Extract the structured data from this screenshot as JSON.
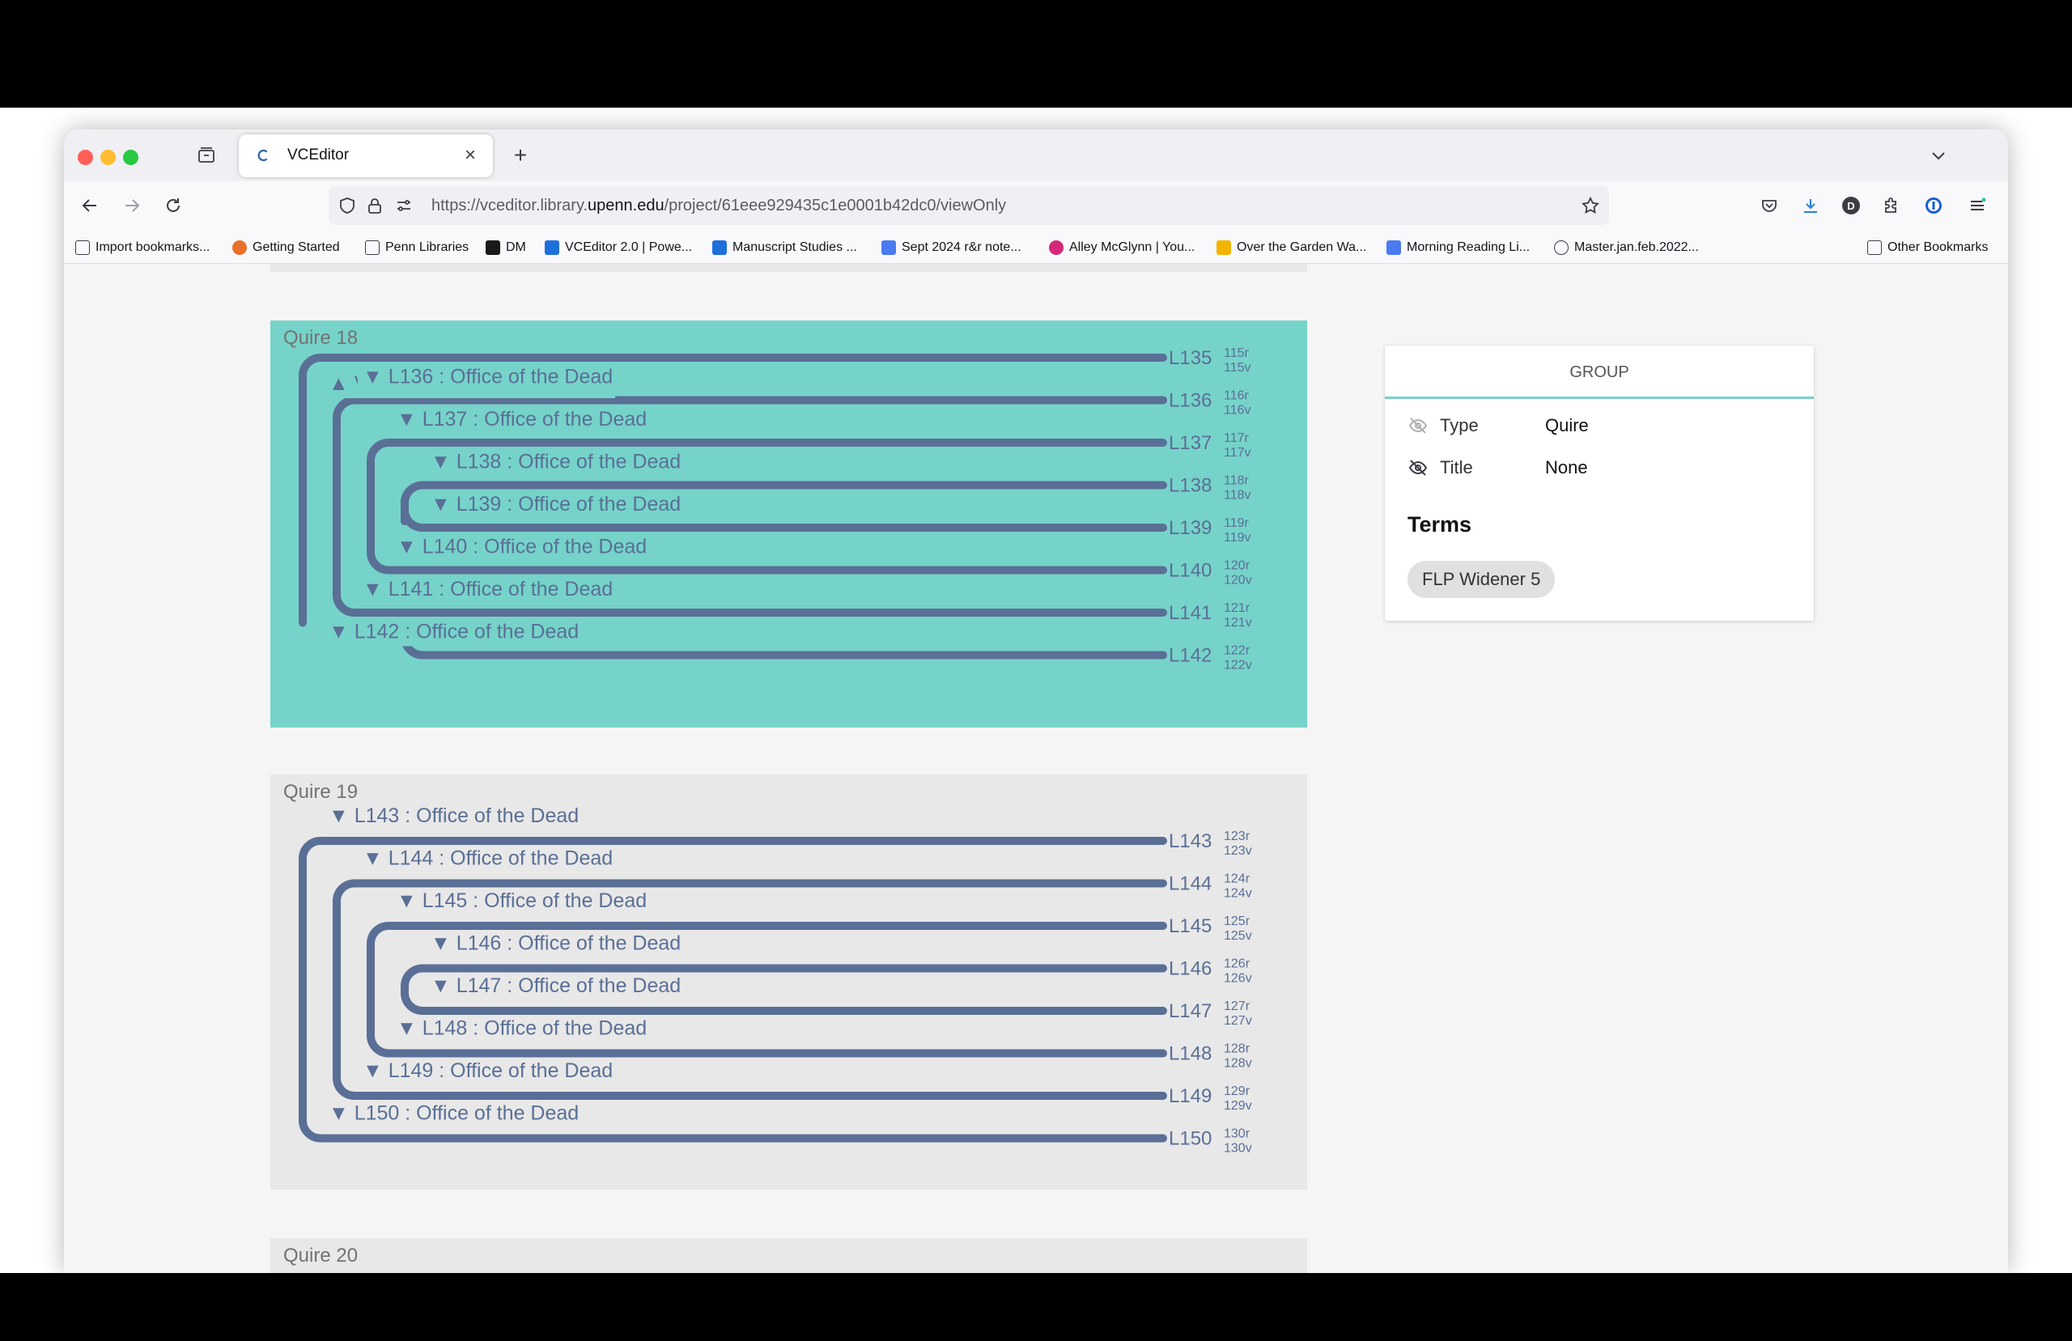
{
  "browser": {
    "tab_title": "VCEditor",
    "url_prefix": "https://vceditor.library.",
    "url_domain": "upenn.edu",
    "url_path": "/project/61eee929435c1e0001b42dc0/viewOnly",
    "new_tab_glyph": "+",
    "close_glyph": "×",
    "bookmarks": [
      {
        "label": "Import bookmarks...",
        "icon": "import-icon"
      },
      {
        "label": "Getting Started",
        "icon": "firefox-icon",
        "color": "#e8702a"
      },
      {
        "label": "Penn Libraries",
        "icon": "folder-icon"
      },
      {
        "label": "DM",
        "icon": "dm-icon",
        "color": "#1a1a1a"
      },
      {
        "label": "VCEditor 2.0 | Powe...",
        "icon": "box-icon",
        "color": "#1d6fdc"
      },
      {
        "label": "Manuscript Studies ...",
        "icon": "box-icon",
        "color": "#1d6fdc"
      },
      {
        "label": "Sept 2024 r&r note...",
        "icon": "docs-icon",
        "color": "#4a7bf0"
      },
      {
        "label": "Alley McGlynn | You...",
        "icon": "instagram-icon",
        "color": "#d6287a"
      },
      {
        "label": "Over the Garden Wa...",
        "icon": "drive-icon",
        "color": "#f4b400"
      },
      {
        "label": "Morning Reading Li...",
        "icon": "docs-icon",
        "color": "#4a7bf0"
      },
      {
        "label": "Master.jan.feb.2022...",
        "icon": "globe-icon"
      }
    ],
    "other_bookmarks": "Other Bookmarks"
  },
  "colors": {
    "selected_quire_bg": "#76d3c9",
    "quire_bg": "#e8e8e8",
    "leaf_color": "#5a6f96",
    "accent": "#73d2c6"
  },
  "quires": [
    {
      "title": "Quire 18",
      "selected": true,
      "conjoins": [
        [
          "L135",
          null
        ],
        [
          "L136",
          "L141"
        ],
        [
          "L137",
          "L140"
        ],
        [
          "L138",
          null
        ],
        [
          "L139",
          null
        ],
        [
          "L142",
          null
        ]
      ],
      "tree_lines": [
        {
          "text": "▲ V : Office of the Dead",
          "indent": 0
        },
        {
          "text": "▼ L136 : Office of the Dead",
          "indent": 1
        },
        {
          "text": "▼ L137 : Office of the Dead",
          "indent": 2
        },
        {
          "text": "▼ L138 : Office of the Dead",
          "indent": 3
        },
        {
          "text": "▼ L139 : Office of the Dead",
          "indent": 3
        },
        {
          "text": "▼ L140 : Office of the Dead",
          "indent": 2
        },
        {
          "text": "▼ L141 : Office of the Dead",
          "indent": 1
        },
        {
          "text": "▼ L142 : Office of the Dead",
          "indent": 0
        }
      ],
      "leaves": [
        {
          "id": "L135",
          "recto": "115r",
          "verso": "115v"
        },
        {
          "id": "L136",
          "recto": "116r",
          "verso": "116v"
        },
        {
          "id": "L137",
          "recto": "117r",
          "verso": "117v"
        },
        {
          "id": "L138",
          "recto": "118r",
          "verso": "118v"
        },
        {
          "id": "L139",
          "recto": "119r",
          "verso": "119v"
        },
        {
          "id": "L140",
          "recto": "120r",
          "verso": "120v"
        },
        {
          "id": "L141",
          "recto": "121r",
          "verso": "121v"
        },
        {
          "id": "L142",
          "recto": "122r",
          "verso": "122v"
        }
      ]
    },
    {
      "title": "Quire 19",
      "selected": false,
      "conjoins": [
        [
          "L143",
          "L150"
        ],
        [
          "L144",
          "L149"
        ],
        [
          "L145",
          "L148"
        ],
        [
          "L146",
          "L147"
        ]
      ],
      "tree_lines": [
        {
          "text": "▼ L143 : Office of the Dead",
          "indent": 0
        },
        {
          "text": "▼ L144 : Office of the Dead",
          "indent": 1
        },
        {
          "text": "▼ L145 : Office of the Dead",
          "indent": 2
        },
        {
          "text": "▼ L146 : Office of the Dead",
          "indent": 3
        },
        {
          "text": "▼ L147 : Office of the Dead",
          "indent": 3
        },
        {
          "text": "▼ L148 : Office of the Dead",
          "indent": 2
        },
        {
          "text": "▼ L149 : Office of the Dead",
          "indent": 1
        },
        {
          "text": "▼ L150 : Office of the Dead",
          "indent": 0
        }
      ],
      "leaves": [
        {
          "id": "L143",
          "recto": "123r",
          "verso": "123v"
        },
        {
          "id": "L144",
          "recto": "124r",
          "verso": "124v"
        },
        {
          "id": "L145",
          "recto": "125r",
          "verso": "125v"
        },
        {
          "id": "L146",
          "recto": "126r",
          "verso": "126v"
        },
        {
          "id": "L147",
          "recto": "127r",
          "verso": "127v"
        },
        {
          "id": "L148",
          "recto": "128r",
          "verso": "128v"
        },
        {
          "id": "L149",
          "recto": "129r",
          "verso": "129v"
        },
        {
          "id": "L150",
          "recto": "130r",
          "verso": "130v"
        }
      ]
    },
    {
      "title": "Quire 20"
    }
  ],
  "panel": {
    "header": "GROUP",
    "rows": [
      {
        "label": "Type",
        "value": "Quire"
      },
      {
        "label": "Title",
        "value": "None"
      }
    ],
    "terms_heading": "Terms",
    "term_chip": "FLP Widener 5"
  }
}
